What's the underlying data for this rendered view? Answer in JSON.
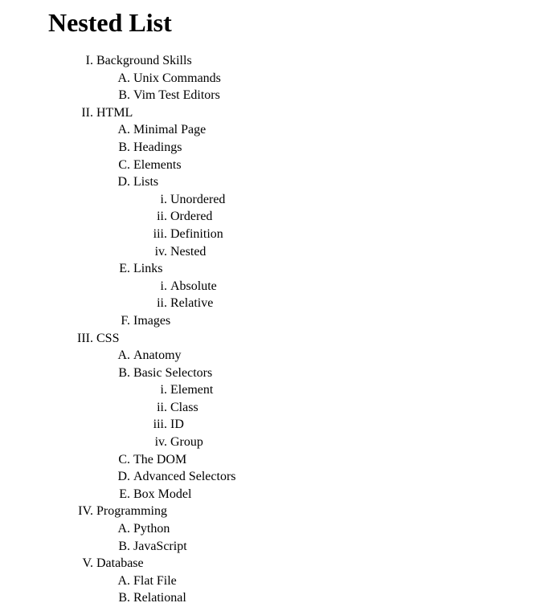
{
  "title": "Nested List",
  "items": [
    {
      "label": "Background Skills",
      "children": [
        {
          "label": "Unix Commands"
        },
        {
          "label": "Vim Test Editors"
        }
      ]
    },
    {
      "label": "HTML",
      "children": [
        {
          "label": "Minimal Page"
        },
        {
          "label": "Headings"
        },
        {
          "label": "Elements"
        },
        {
          "label": "Lists",
          "children": [
            {
              "label": "Unordered"
            },
            {
              "label": "Ordered"
            },
            {
              "label": "Definition"
            },
            {
              "label": "Nested"
            }
          ]
        },
        {
          "label": "Links",
          "children": [
            {
              "label": "Absolute"
            },
            {
              "label": "Relative"
            }
          ]
        },
        {
          "label": "Images"
        }
      ]
    },
    {
      "label": "CSS",
      "children": [
        {
          "label": "Anatomy"
        },
        {
          "label": "Basic Selectors",
          "children": [
            {
              "label": "Element"
            },
            {
              "label": "Class"
            },
            {
              "label": "ID"
            },
            {
              "label": "Group"
            }
          ]
        },
        {
          "label": "The DOM"
        },
        {
          "label": "Advanced Selectors"
        },
        {
          "label": "Box Model"
        }
      ]
    },
    {
      "label": "Programming",
      "children": [
        {
          "label": "Python"
        },
        {
          "label": "JavaScript"
        }
      ]
    },
    {
      "label": "Database",
      "children": [
        {
          "label": "Flat File"
        },
        {
          "label": "Relational"
        }
      ]
    }
  ]
}
